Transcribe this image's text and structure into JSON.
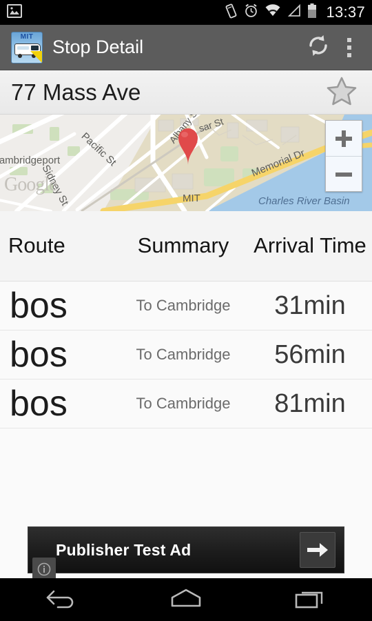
{
  "status_bar": {
    "notification_icon": "image-icon",
    "icons": [
      "vibrate-icon",
      "alarm-clock-icon",
      "wifi-icon",
      "signal-icon",
      "battery-icon"
    ],
    "time": "13:37"
  },
  "action_bar": {
    "app_icon": "mit-bus-app-icon",
    "app_icon_text": "MIT",
    "title": "Stop Detail",
    "refresh_icon": "refresh-icon",
    "overflow_icon": "overflow-menu-icon"
  },
  "stop_header": {
    "name": "77 Mass Ave",
    "favorite_icon": "star-outline-icon",
    "favorited": false
  },
  "map": {
    "provider_watermark": "Google",
    "marker_icon": "map-pin-icon",
    "zoom_in_label": "+",
    "zoom_out_label": "−",
    "labels": [
      {
        "text": "Cambridgeport",
        "type": "neighborhood"
      },
      {
        "text": "Pacific St",
        "type": "street"
      },
      {
        "text": "Sidney St",
        "type": "street"
      },
      {
        "text": "Albany St",
        "type": "street"
      },
      {
        "text": "sar St",
        "type": "street"
      },
      {
        "text": "Memorial Dr",
        "type": "street"
      },
      {
        "text": "MIT",
        "type": "place"
      },
      {
        "text": "Charles River Basin",
        "type": "water"
      }
    ]
  },
  "arrivals_table": {
    "headers": {
      "route": "Route",
      "summary": "Summary",
      "arrival": "Arrival Time"
    },
    "rows": [
      {
        "route": "bos",
        "summary": "To Cambridge",
        "arrival": "31min"
      },
      {
        "route": "bos",
        "summary": "To Cambridge",
        "arrival": "56min"
      },
      {
        "route": "bos",
        "summary": "To Cambridge",
        "arrival": "81min"
      }
    ]
  },
  "ad_banner": {
    "text": "Publisher Test Ad",
    "info_icon": "info-icon",
    "action_icon": "arrow-right-icon"
  },
  "nav_bar": {
    "back_icon": "back-icon",
    "home_icon": "home-icon",
    "recents_icon": "recents-icon"
  },
  "colors": {
    "action_bar": "#5c5c5c",
    "marker": "#e04a4a",
    "water": "#9cc7e8",
    "land": "#e8e1d0"
  }
}
